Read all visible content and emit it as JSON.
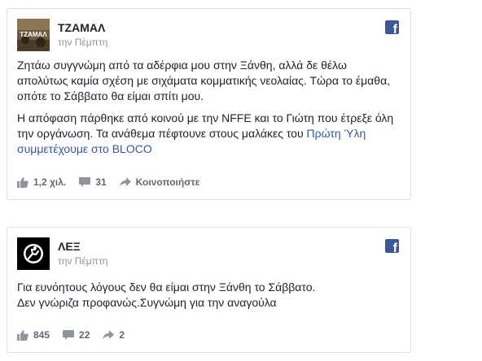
{
  "posts": [
    {
      "page_name": "ΤΖΑΜΑΛ",
      "timestamp": "την Πέμπτη",
      "avatar_text": "ΤΖΑΜΑΛ",
      "paragraph_1": "Ζητάω συγγνώμη από τα αδέρφια μου στην Ξάνθη, αλλά δε θέλω απολύτως καμία σχέση με σιχάματα κομματικής νεολαίας. Τώρα το έμαθα, οπότε το Σάββατο θα είμαι σπίτι μου.",
      "paragraph_2_text": "Η απόφαση πάρθηκε από κοινού με την NFFE και το Γιώτη που έτρεξε όλη την οργάνωση. Τα ανάθεμα πέφτουνε στους μαλάκες του ",
      "link_1": "Πρώτη Ύλη",
      "link_2": "συμμετέχουμε στο BLOCO",
      "likes": "1,2 χιλ.",
      "comments": "31",
      "share_label": "Κοινοποιήστε"
    },
    {
      "page_name": "ΛΕΞ",
      "timestamp": "την Πέμπτη",
      "line_1": "Για ευνόητους λόγους δεν θα είμαι στην Ξάνθη το Σάββατο.",
      "line_2": "Δεν γνώριζα προφανώς.Συγνώμη για την αναγούλα",
      "likes": "845",
      "comments": "22",
      "shares": "2"
    }
  ],
  "colors": {
    "facebook_blue": "#3b5998",
    "link": "#365899",
    "meta_text": "#90949c",
    "footer_text": "#616770",
    "border": "#dddfe2"
  },
  "icons": [
    "facebook-logo-icon",
    "like-thumb-icon",
    "comment-icon",
    "share-arrow-icon"
  ]
}
